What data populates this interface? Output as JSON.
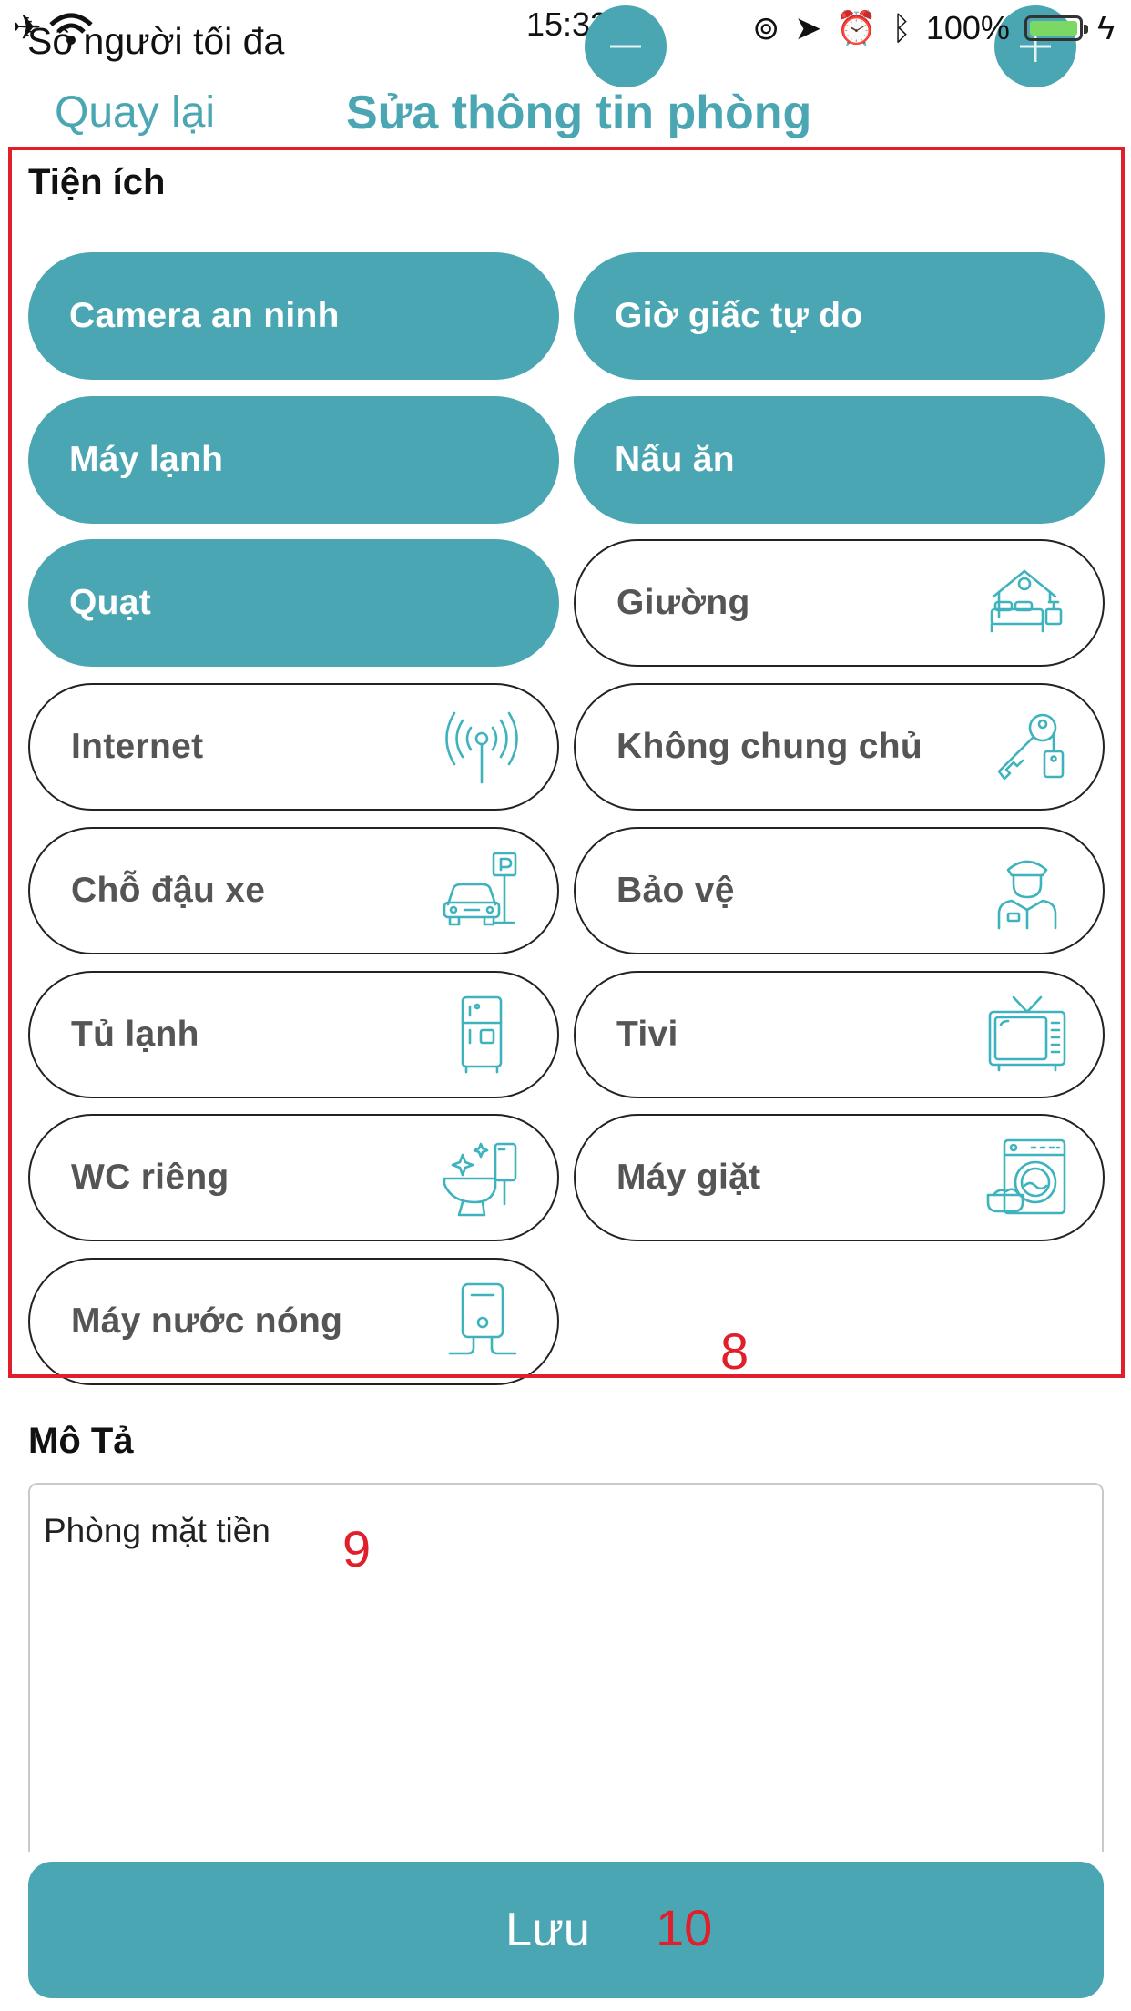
{
  "status_bar": {
    "time": "15:33",
    "battery": "100%",
    "behind_label": "Số người tối đa"
  },
  "nav": {
    "back_label": "Quay lại",
    "title": "Sửa thông tin phòng"
  },
  "amenities": {
    "label": "Tiện ích",
    "items": [
      {
        "label": "Camera an ninh",
        "selected": true,
        "icon": "camera-icon"
      },
      {
        "label": "Giờ giấc tự do",
        "selected": true,
        "icon": "clock-icon"
      },
      {
        "label": "Máy lạnh",
        "selected": true,
        "icon": "air-conditioner-icon"
      },
      {
        "label": "Nấu ăn",
        "selected": true,
        "icon": "cooking-icon"
      },
      {
        "label": "Quạt",
        "selected": true,
        "icon": "fan-icon"
      },
      {
        "label": "Giường",
        "selected": false,
        "icon": "bed-icon"
      },
      {
        "label": "Internet",
        "selected": false,
        "icon": "antenna-icon"
      },
      {
        "label": "Không chung chủ",
        "selected": false,
        "icon": "keys-icon"
      },
      {
        "label": "Chỗ đậu xe",
        "selected": false,
        "icon": "parking-icon"
      },
      {
        "label": "Bảo vệ",
        "selected": false,
        "icon": "security-guard-icon"
      },
      {
        "label": "Tủ lạnh",
        "selected": false,
        "icon": "fridge-icon"
      },
      {
        "label": "Tivi",
        "selected": false,
        "icon": "tv-icon"
      },
      {
        "label": "WC riêng",
        "selected": false,
        "icon": "toilet-icon"
      },
      {
        "label": "Máy giặt",
        "selected": false,
        "icon": "washing-machine-icon"
      },
      {
        "label": "Máy nước nóng",
        "selected": false,
        "icon": "water-heater-icon"
      }
    ]
  },
  "description": {
    "label": "Mô Tả",
    "value": "Phòng mặt tiền"
  },
  "save_button": {
    "label": "Lưu"
  },
  "annotations": {
    "amenities": "8",
    "description": "9",
    "save": "10"
  },
  "colors": {
    "accent": "#4aa6b3",
    "icon": "#3fb3bd",
    "annotation": "#e01f2a"
  }
}
